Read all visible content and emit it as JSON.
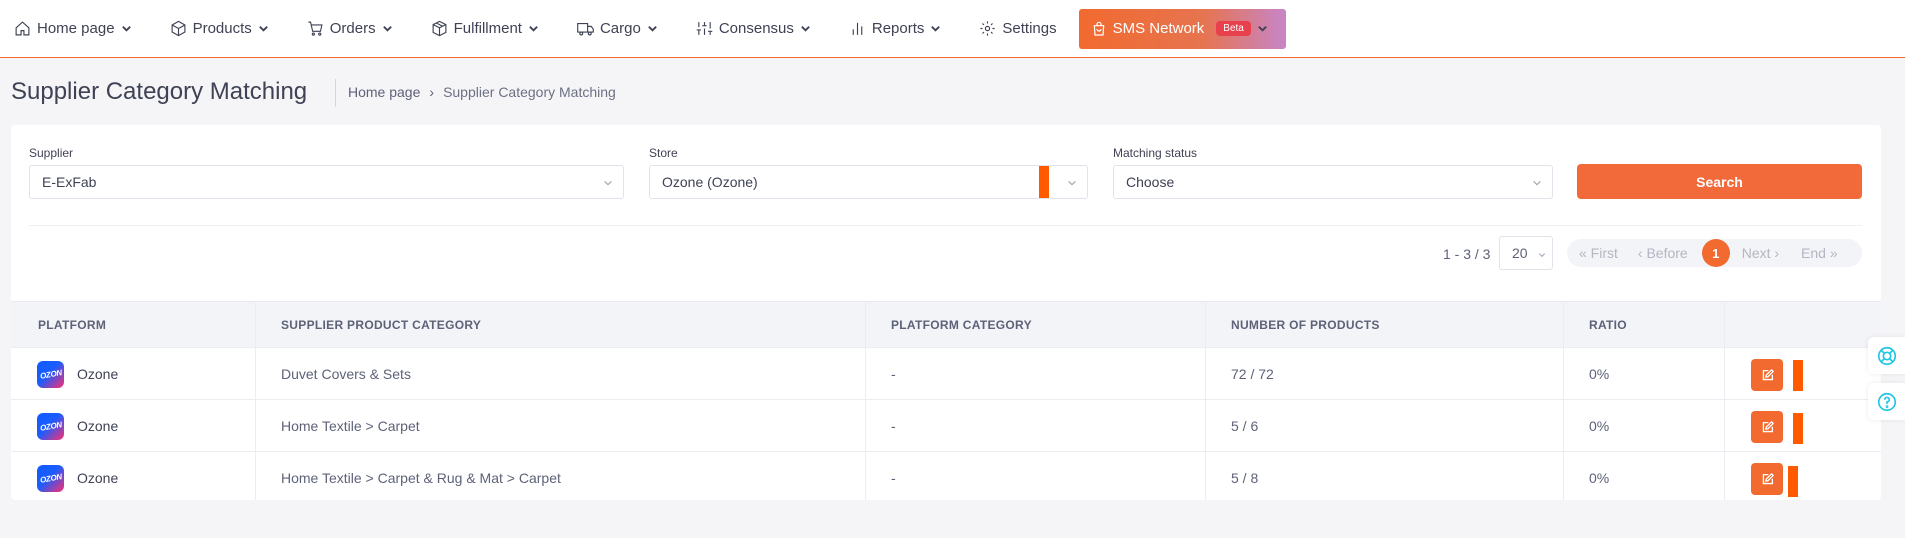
{
  "nav": {
    "items": [
      {
        "label": "Home page",
        "icon": "home-icon",
        "dropdown": true
      },
      {
        "label": "Products",
        "icon": "box-icon",
        "dropdown": true
      },
      {
        "label": "Orders",
        "icon": "cart-icon",
        "dropdown": true
      },
      {
        "label": "Fulfillment",
        "icon": "package-icon",
        "dropdown": true
      },
      {
        "label": "Cargo",
        "icon": "truck-icon",
        "dropdown": true
      },
      {
        "label": "Consensus",
        "icon": "sliders-icon",
        "dropdown": true
      },
      {
        "label": "Reports",
        "icon": "bar-chart-icon",
        "dropdown": true
      },
      {
        "label": "Settings",
        "icon": "gear-icon",
        "dropdown": false
      }
    ],
    "sms": {
      "label": "SMS Network",
      "badge": "Beta",
      "icon": "shopping-bag-icon"
    }
  },
  "page": {
    "title": "Supplier Category Matching",
    "breadcrumb": {
      "home": "Home page",
      "separator": "›",
      "current": "Supplier Category Matching"
    }
  },
  "filters": {
    "supplier": {
      "label": "Supplier",
      "value": "E-ExFab"
    },
    "store": {
      "label": "Store",
      "value": "Ozone (Ozone)"
    },
    "matching_status": {
      "label": "Matching status",
      "value": "Choose"
    },
    "search_label": "Search"
  },
  "pagination": {
    "range": "1 - 3 / 3",
    "page_size": "20",
    "first": "« First",
    "before": "‹ Before",
    "current": "1",
    "next": "Next ›",
    "end": "End »"
  },
  "table": {
    "columns": [
      "PLATFORM",
      "SUPPLIER PRODUCT CATEGORY",
      "PLATFORM CATEGORY",
      "NUMBER OF PRODUCTS",
      "RATIO"
    ],
    "rows": [
      {
        "platform": "Ozone",
        "logo_text": "OZON",
        "supplier_category": "Duvet Covers & Sets",
        "platform_category": "-",
        "products": "72 / 72",
        "ratio": "0%"
      },
      {
        "platform": "Ozone",
        "logo_text": "OZON",
        "supplier_category": "Home Textile > Carpet",
        "platform_category": "-",
        "products": "5 / 6",
        "ratio": "0%"
      },
      {
        "platform": "Ozone",
        "logo_text": "OZON",
        "supplier_category": "Home Textile > Carpet & Rug & Mat > Carpet",
        "platform_category": "-",
        "products": "5 / 8",
        "ratio": "0%"
      }
    ]
  },
  "colors": {
    "accent": "#f26a2f",
    "marker": "#ff5a00",
    "help": "#1ec6e6",
    "beta": "#e8404c"
  },
  "floating": [
    {
      "icon": "lifebuoy-icon"
    },
    {
      "icon": "question-icon"
    }
  ]
}
